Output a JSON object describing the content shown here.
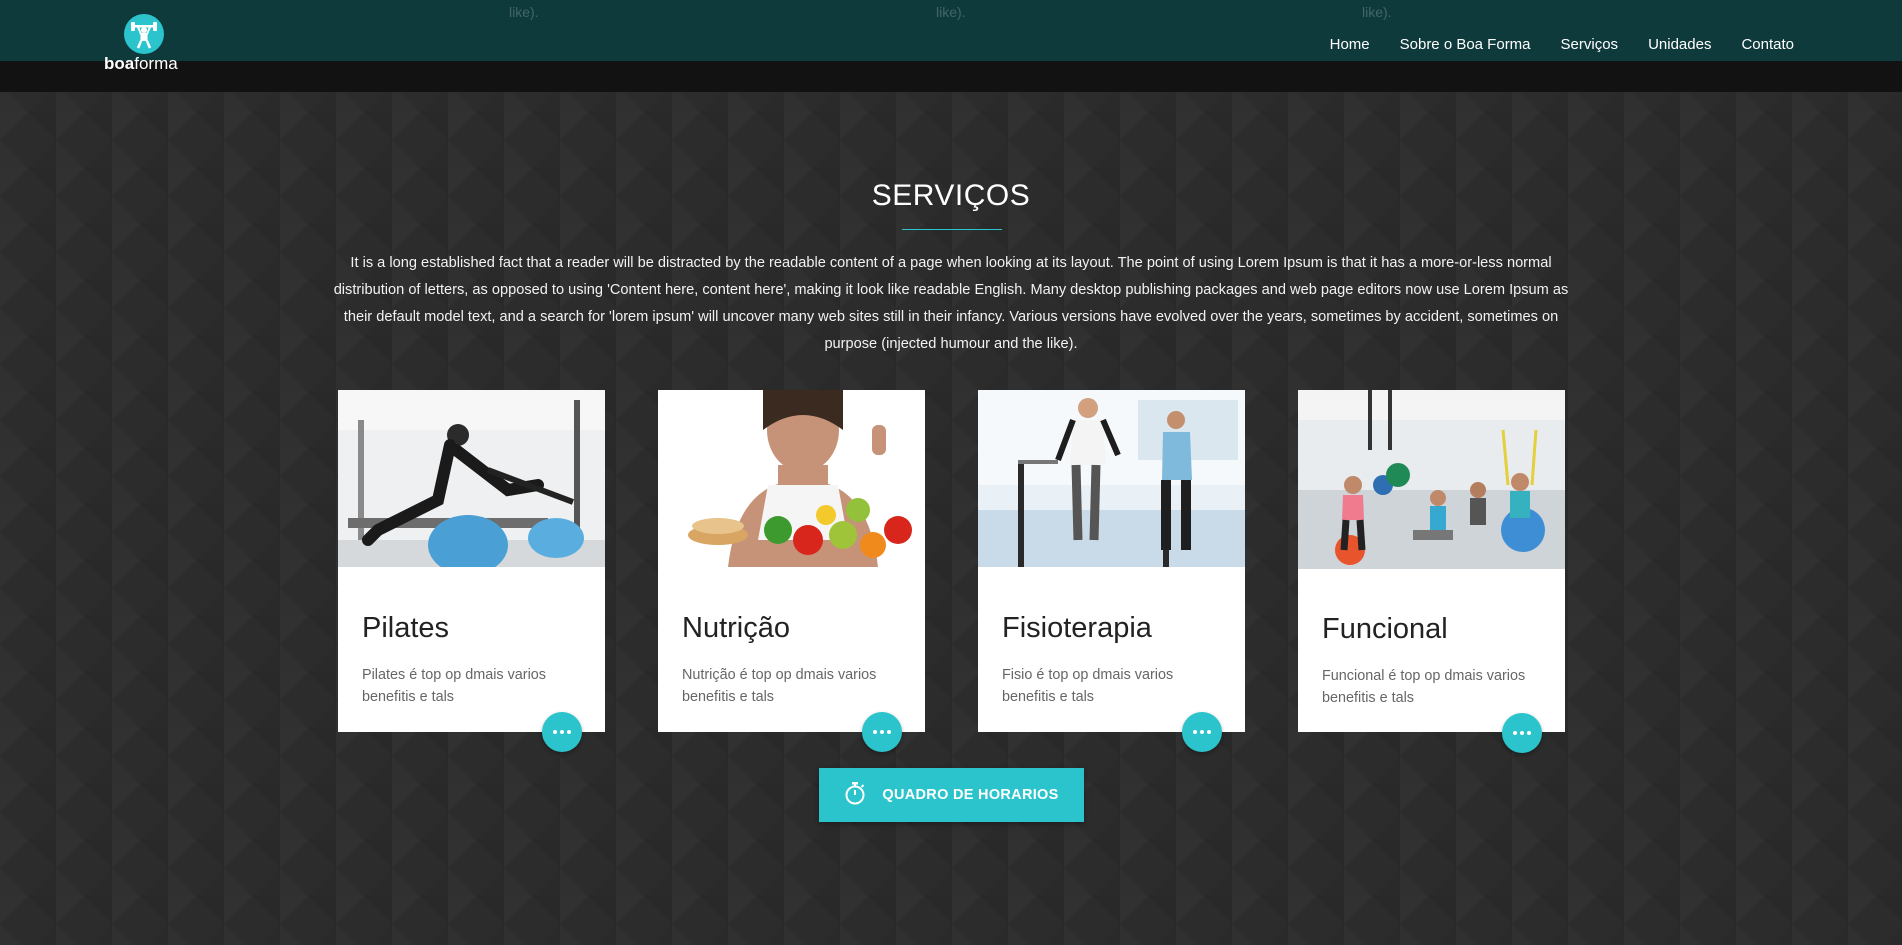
{
  "colors": {
    "accent": "#2cc4cc",
    "navbar": "#0e3a3c",
    "background": "#2c2c2c"
  },
  "header": {
    "ghost_texts": [
      "like).",
      "like).",
      "like)."
    ],
    "logo": {
      "text_bold": "boa",
      "text_regular": "forma",
      "icon": "weightlifter-icon"
    },
    "nav": [
      "Home",
      "Sobre o Boa Forma",
      "Serviços",
      "Unidades",
      "Contato"
    ]
  },
  "services": {
    "title": "SERVIÇOS",
    "intro": "It is a long established fact that a reader will be distracted by the readable content of a page when looking at its layout. The point of using Lorem Ipsum is that it has a more-or-less normal distribution of letters, as opposed to using 'Content here, content here', making it look like readable English. Many desktop publishing packages and web page editors now use Lorem Ipsum as their default model text, and a search for 'lorem ipsum' will uncover many web sites still in their infancy. Various versions have evolved over the years, sometimes by accident, sometimes on purpose (injected humour and the like).",
    "cards": [
      {
        "title": "Pilates",
        "text": "Pilates é top op dmais varios benefitis e tals",
        "more_icon": "more-dots-icon"
      },
      {
        "title": "Nutrição",
        "text": "Nutrição é top op dmais varios benefitis e tals",
        "more_icon": "more-dots-icon"
      },
      {
        "title": "Fisioterapia",
        "text": "Fisio é top op dmais varios benefitis e tals",
        "more_icon": "more-dots-icon"
      },
      {
        "title": "Funcional",
        "text": "Funcional é top op dmais varios benefitis e tals",
        "more_icon": "more-dots-icon"
      }
    ],
    "schedule_button": {
      "label": "QUADRO DE HORARIOS",
      "icon": "stopwatch-icon"
    }
  }
}
